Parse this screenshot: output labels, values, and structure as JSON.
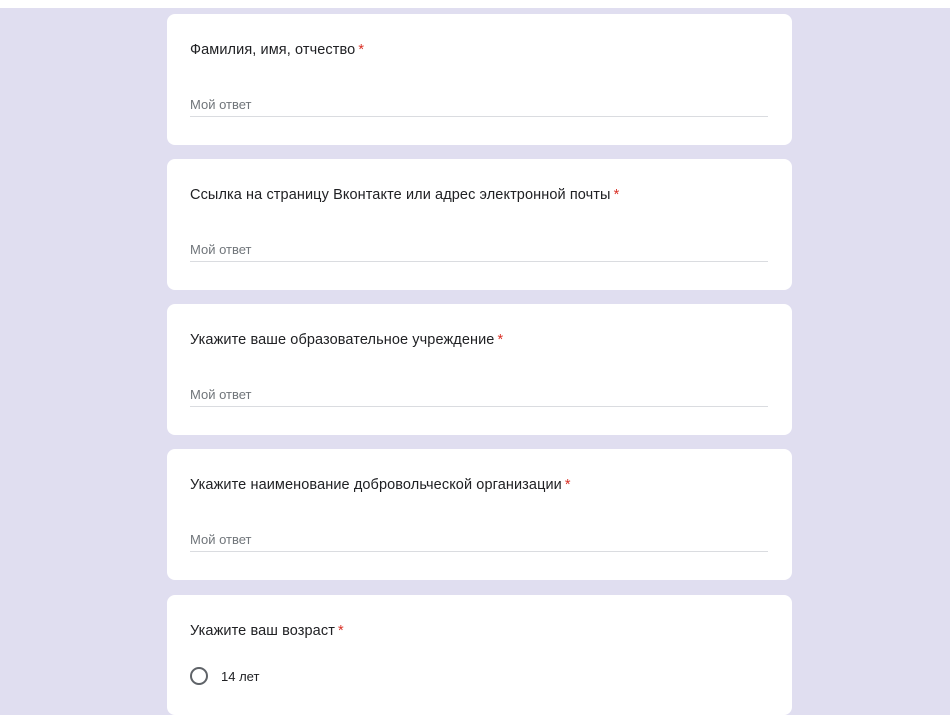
{
  "form": {
    "questions": [
      {
        "label": "Фамилия, имя, отчество",
        "required_mark": "*",
        "answer_placeholder": "Мой ответ",
        "answer_value": ""
      },
      {
        "label": "Ссылка на страницу Вконтакте или адрес электронной почты",
        "required_mark": "*",
        "answer_placeholder": "Мой ответ",
        "answer_value": ""
      },
      {
        "label": "Укажите ваше образовательное учреждение",
        "required_mark": "*",
        "answer_placeholder": "Мой ответ",
        "answer_value": ""
      },
      {
        "label": "Укажите наименование добровольческой организации",
        "required_mark": "*",
        "answer_placeholder": "Мой ответ",
        "answer_value": ""
      },
      {
        "label": "Укажите ваш возраст",
        "required_mark": "*",
        "options": [
          {
            "label": "14 лет",
            "selected": false
          }
        ]
      }
    ]
  },
  "colors": {
    "background": "#e0def0",
    "card": "#ffffff",
    "required": "#d93025",
    "text": "#202124",
    "placeholder": "#70757a",
    "underline": "#dadce0"
  }
}
